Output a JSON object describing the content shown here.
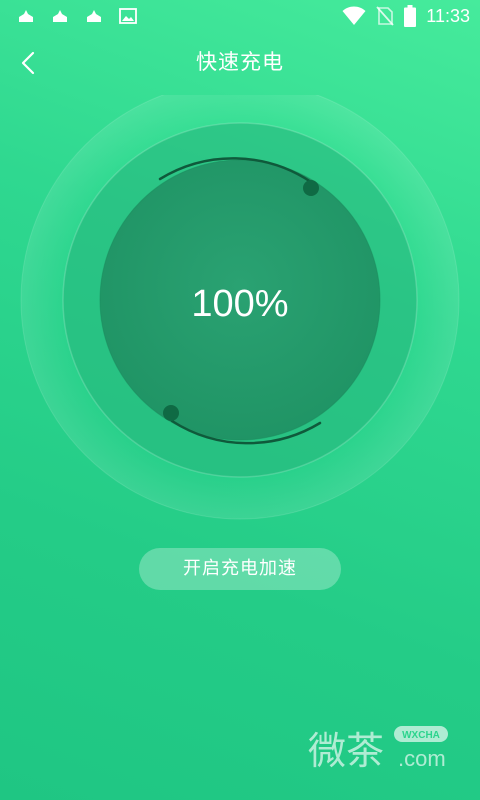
{
  "status_bar": {
    "time": "11:33",
    "icons": [
      "notification-icon",
      "notification-icon",
      "notification-icon",
      "image-icon",
      "wifi-icon",
      "no-sim-icon",
      "battery-icon"
    ]
  },
  "header": {
    "back_icon": "chevron-left-icon",
    "title": "快速充电"
  },
  "gauge": {
    "percent_label": "100%",
    "level": 1.0
  },
  "boost_button": {
    "label": "开启充电加速"
  },
  "watermark": {
    "text": "微茶",
    "badge": "WXCHA",
    "domain": ".com"
  },
  "colors": {
    "background_top": "#46eb9c",
    "background_bottom": "#1fc683",
    "inner_circle": "#239a6b",
    "text": "#ffffff"
  }
}
